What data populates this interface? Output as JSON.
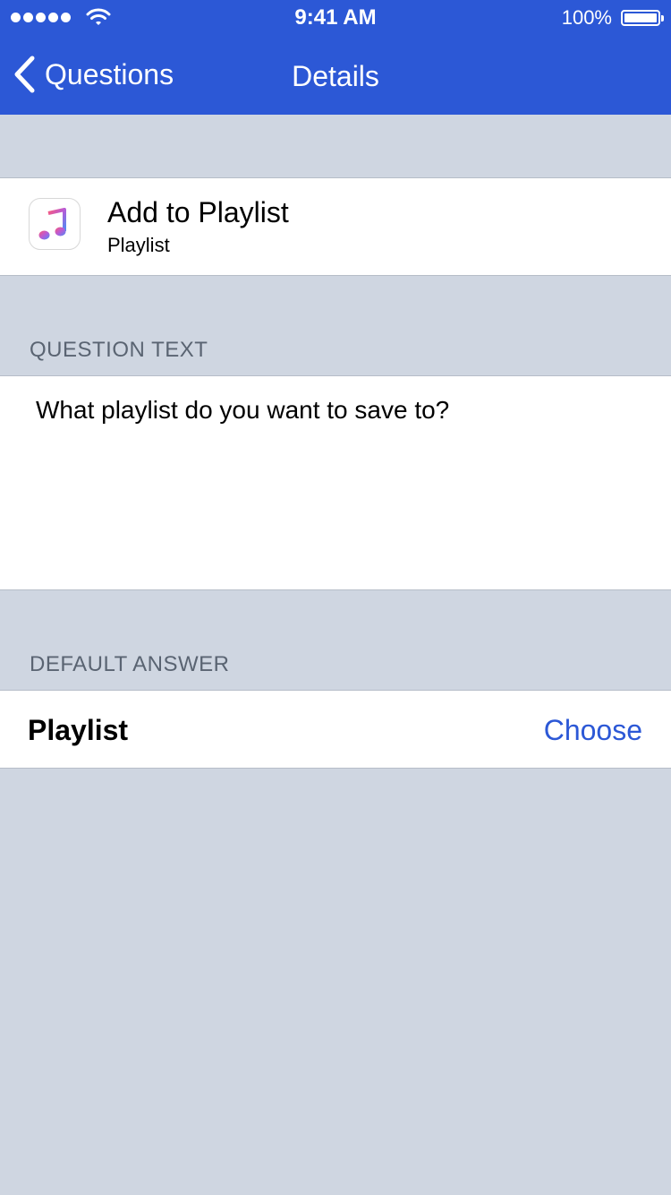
{
  "status_bar": {
    "time": "9:41 AM",
    "battery_percent": "100%"
  },
  "nav": {
    "back_label": "Questions",
    "title": "Details"
  },
  "action": {
    "title": "Add to Playlist",
    "subtitle": "Playlist",
    "icon": "music-note-icon"
  },
  "question_section": {
    "header": "QUESTION TEXT",
    "text": "What playlist do you want to save to?"
  },
  "answer_section": {
    "header": "DEFAULT ANSWER",
    "label": "Playlist",
    "choose_label": "Choose"
  },
  "colors": {
    "accent": "#2c58d6",
    "background": "#cfd6e1"
  }
}
